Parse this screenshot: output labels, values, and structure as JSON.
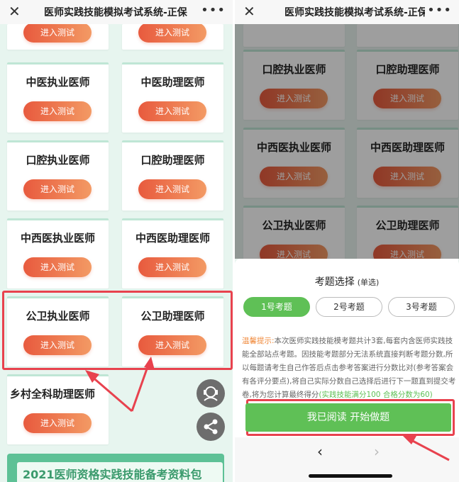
{
  "window_title": "医师实践技能模拟考试系统-正保",
  "enter_label": "进入测试",
  "left": {
    "cards": [
      {
        "name": "中医执业医师"
      },
      {
        "name": "中医助理医师"
      },
      {
        "name": "口腔执业医师"
      },
      {
        "name": "口腔助理医师"
      },
      {
        "name": "中西医执业医师"
      },
      {
        "name": "中西医助理医师"
      },
      {
        "name": "公卫执业医师"
      },
      {
        "name": "公卫助理医师"
      },
      {
        "name": "乡村全科助理医师"
      }
    ],
    "banner_text": "2021医师资格实践技能备考资料包"
  },
  "right": {
    "bg_cards": [
      {
        "name": "口腔执业医师"
      },
      {
        "name": "口腔助理医师"
      },
      {
        "name": "中西医执业医师"
      },
      {
        "name": "中西医助理医师"
      },
      {
        "name": "公卫执业医师"
      },
      {
        "name": "公卫助理医师"
      }
    ],
    "sheet": {
      "title": "考题选择",
      "title_note": "(单选)",
      "options": [
        {
          "label": "1号考题",
          "selected": true
        },
        {
          "label": "2号考题",
          "selected": false
        },
        {
          "label": "3号考题",
          "selected": false
        }
      ],
      "tip_key": "温馨提示:",
      "tip_body": "本次医师实践技能模考题共计3套,每套内含医师实践技能全部站点考题。因技能考题部分无法系统直接判断考题分数,所以每题请考生自己作答后点击参考答案进行分数比对(参考答案会有各评分要点),将自己实际分数自己选择后进行下一题直到提交考卷,将为您计算最终得分",
      "tip_score": "(实践技能满分100 合格分数为60)",
      "confirm_label": "我已阅读   开始做题"
    }
  },
  "colors": {
    "green": "#5fc056",
    "orange_start": "#e85a3e",
    "orange_end": "#f39a64",
    "highlight": "#e8424e"
  }
}
